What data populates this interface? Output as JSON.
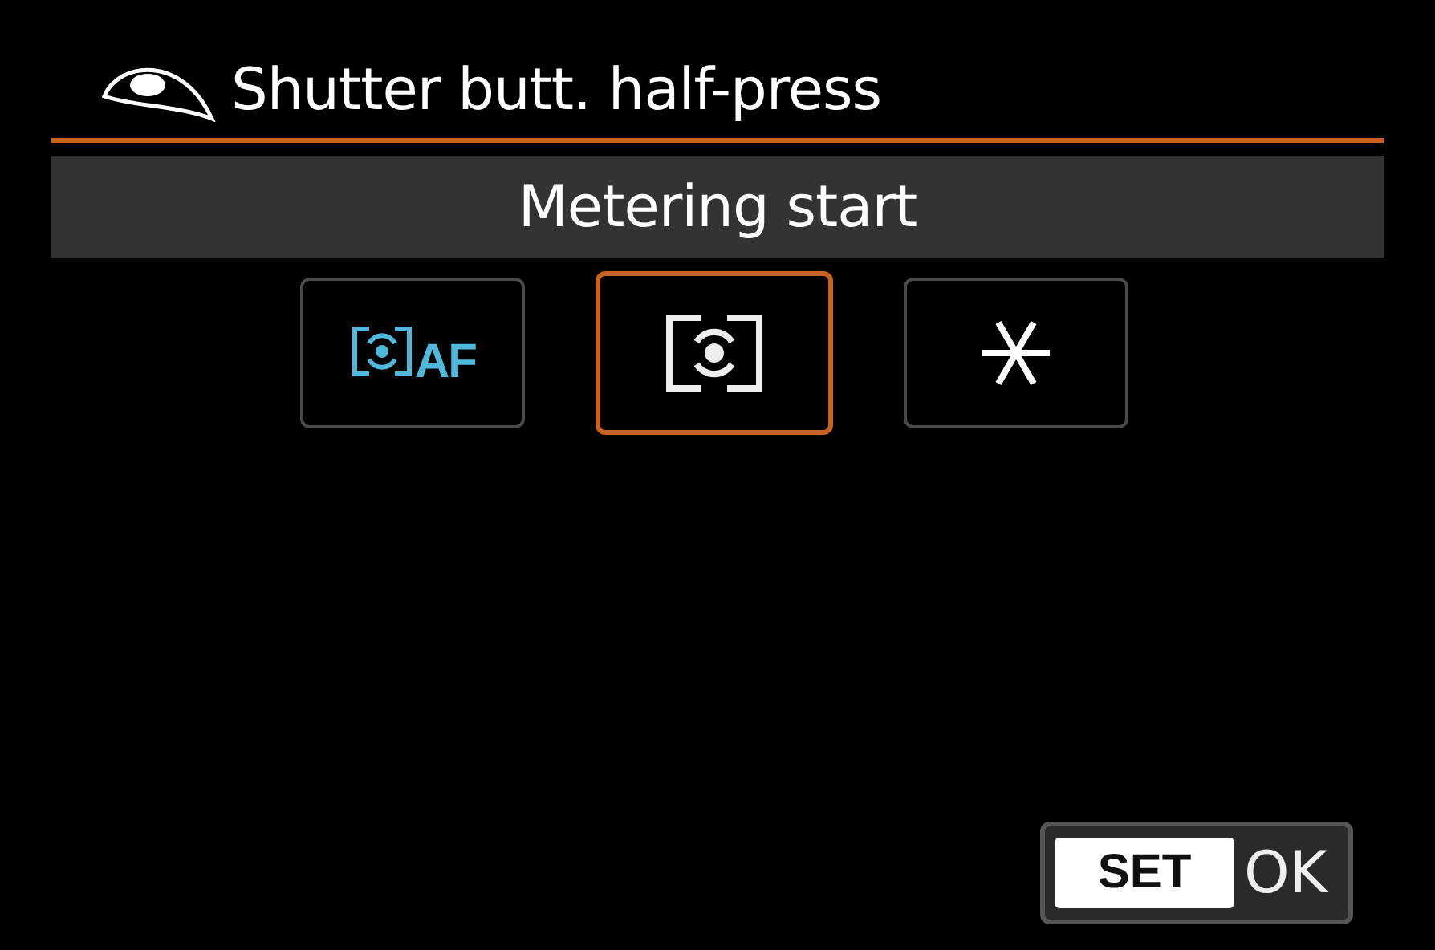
{
  "header": {
    "title": "Shutter butt. half-press"
  },
  "current_setting": "Metering start",
  "options": [
    {
      "kind": "metering-af",
      "label": "AF",
      "selected": false
    },
    {
      "kind": "metering",
      "selected": true
    },
    {
      "kind": "star",
      "selected": false
    }
  ],
  "footer_button": {
    "key": "SET",
    "label": "OK"
  }
}
